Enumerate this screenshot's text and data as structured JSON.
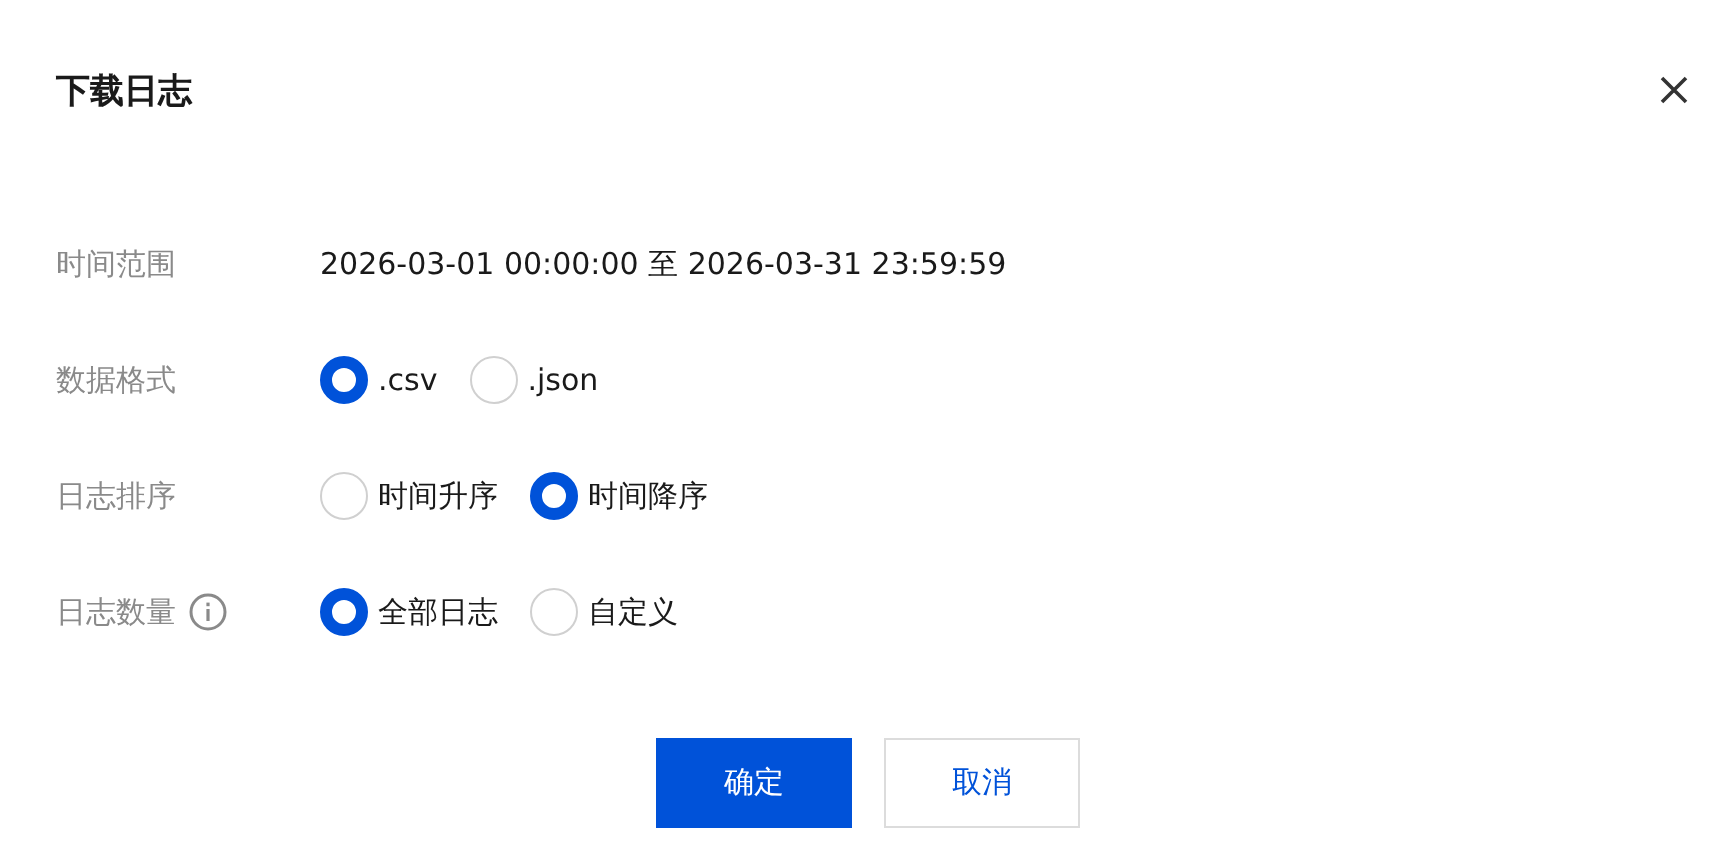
{
  "dialog": {
    "title": "下载日志"
  },
  "fields": [
    {
      "label": "时间范围",
      "kind": "text",
      "info": false,
      "value": "2026-03-01 00:00:00 至 2026-03-31 23:59:59"
    },
    {
      "label": "数据格式",
      "kind": "radio",
      "info": false,
      "options": [
        {
          "label": ".csv",
          "selected": true
        },
        {
          "label": ".json",
          "selected": false
        }
      ]
    },
    {
      "label": "日志排序",
      "kind": "radio",
      "info": false,
      "options": [
        {
          "label": "时间升序",
          "selected": false
        },
        {
          "label": "时间降序",
          "selected": true
        }
      ]
    },
    {
      "label": "日志数量",
      "kind": "radio",
      "info": true,
      "options": [
        {
          "label": "全部日志",
          "selected": true
        },
        {
          "label": "自定义",
          "selected": false
        }
      ]
    }
  ],
  "buttons": [
    {
      "label": "确定",
      "kind": "primary"
    },
    {
      "label": "取消",
      "kind": "secondary"
    }
  ]
}
